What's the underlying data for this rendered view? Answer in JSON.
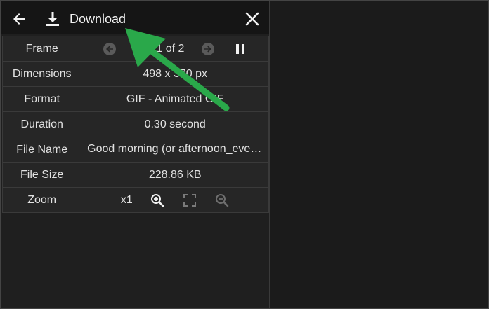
{
  "toolbar": {
    "download_label": "Download",
    "icons": {
      "back": "arrow-left-icon",
      "download": "download-icon",
      "close": "close-icon"
    }
  },
  "rows": {
    "frame": {
      "label": "Frame",
      "value": "1 of 2"
    },
    "dimensions": {
      "label": "Dimensions",
      "value": "498 x 370 px"
    },
    "format": {
      "label": "Format",
      "value": "GIF - Animated GIF"
    },
    "duration": {
      "label": "Duration",
      "value": "0.30 second"
    },
    "file_name": {
      "label": "File Name",
      "value": "Good morning (or afternoon_evening).gif"
    },
    "file_size": {
      "label": "File Size",
      "value": "228.86 KB"
    },
    "zoom": {
      "label": "Zoom",
      "value": "x1"
    }
  },
  "colors": {
    "background": "#1b1b1b",
    "toolbar": "#151515",
    "row": "#262626",
    "border": "#3a3a3a",
    "annotation_arrow": "#2aa84a"
  }
}
